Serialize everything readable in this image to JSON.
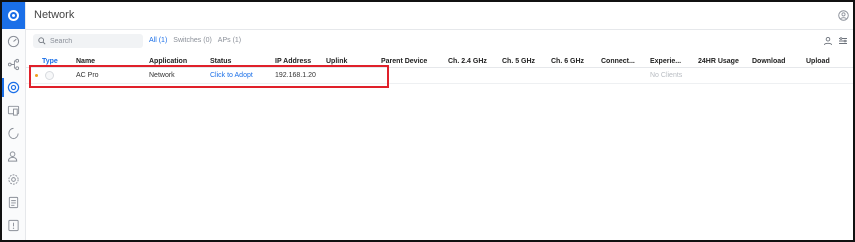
{
  "app": {
    "page_title": "Network",
    "accent_color": "#1a6fe8",
    "highlight_color": "#e0202a"
  },
  "rail": {
    "logo": "ubiquiti-logo-icon",
    "items": [
      "dashboard-icon",
      "topology-icon",
      "devices-icon",
      "clients-icon",
      "insights-icon",
      "users-icon",
      "settings-icon",
      "notes-icon",
      "alerts-icon"
    ],
    "active_index": 2
  },
  "toolbar": {
    "search_placeholder": "Search",
    "filters": [
      {
        "label": "All (1)",
        "active": true
      },
      {
        "label": "Switches (0)",
        "active": false
      },
      {
        "label": "APs (1)",
        "active": false
      }
    ]
  },
  "table": {
    "columns": [
      "Type",
      "Name",
      "Application",
      "Status",
      "IP Address",
      "Uplink",
      "Parent Device",
      "Ch. 2.4 GHz",
      "Ch. 5 GHz",
      "Ch. 6 GHz",
      "Connect...",
      "Experie...",
      "24HR Usage",
      "Download",
      "Upload"
    ],
    "rows": [
      {
        "status_color": "#f0a020",
        "name": "AC Pro",
        "application": "Network",
        "status": "Click to Adopt",
        "ip_address": "192.168.1.20",
        "experience": "No Clients"
      }
    ]
  }
}
